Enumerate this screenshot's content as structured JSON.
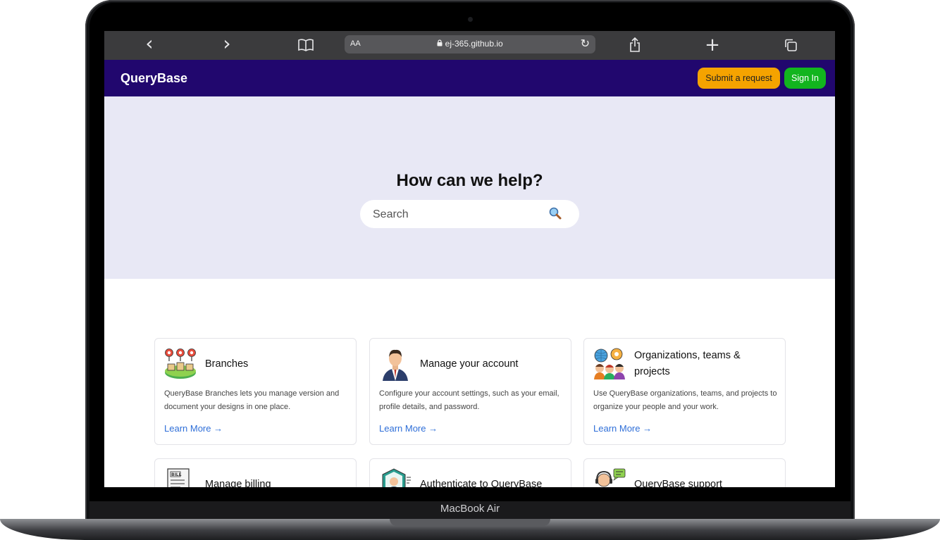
{
  "device": {
    "label": "MacBook Air"
  },
  "browser": {
    "text_size_label": "AA",
    "url": "ej-365.github.io",
    "back_glyph": "‹",
    "forward_glyph": "›",
    "reload_glyph": "↻",
    "plus_glyph": "+"
  },
  "nav": {
    "logo": "QueryBase",
    "submit_label": "Submit a request",
    "signin_label": "Sign In"
  },
  "hero": {
    "title": "How can we help?",
    "search_placeholder": "Search"
  },
  "cards": [
    {
      "title": "Branches",
      "description": "QueryBase Branches lets you manage version and document your designs in one place.",
      "link": "Learn More →",
      "icon": "map-pins-icon"
    },
    {
      "title": "Manage your account",
      "description": "Configure your account settings, such as your email, profile details, and password.",
      "link": "Learn More →",
      "icon": "businessman-icon"
    },
    {
      "title": "Organizations, teams & projects",
      "description": "Use QueryBase organizations, teams, and projects to organize your people and your work.",
      "link": "Learn More →",
      "icon": "team-icon"
    },
    {
      "title": "Manage billing",
      "icon": "bill-icon"
    },
    {
      "title": "Authenticate to QueryBase",
      "icon": "shield-user-icon"
    },
    {
      "title": "QueryBase support",
      "icon": "support-agent-icon"
    }
  ],
  "colors": {
    "nav_bg": "#21076e",
    "hero_bg": "#e8e8f5",
    "submit_bg": "#f5a300",
    "signin_bg": "#12b51e",
    "link": "#2f6fd8"
  }
}
